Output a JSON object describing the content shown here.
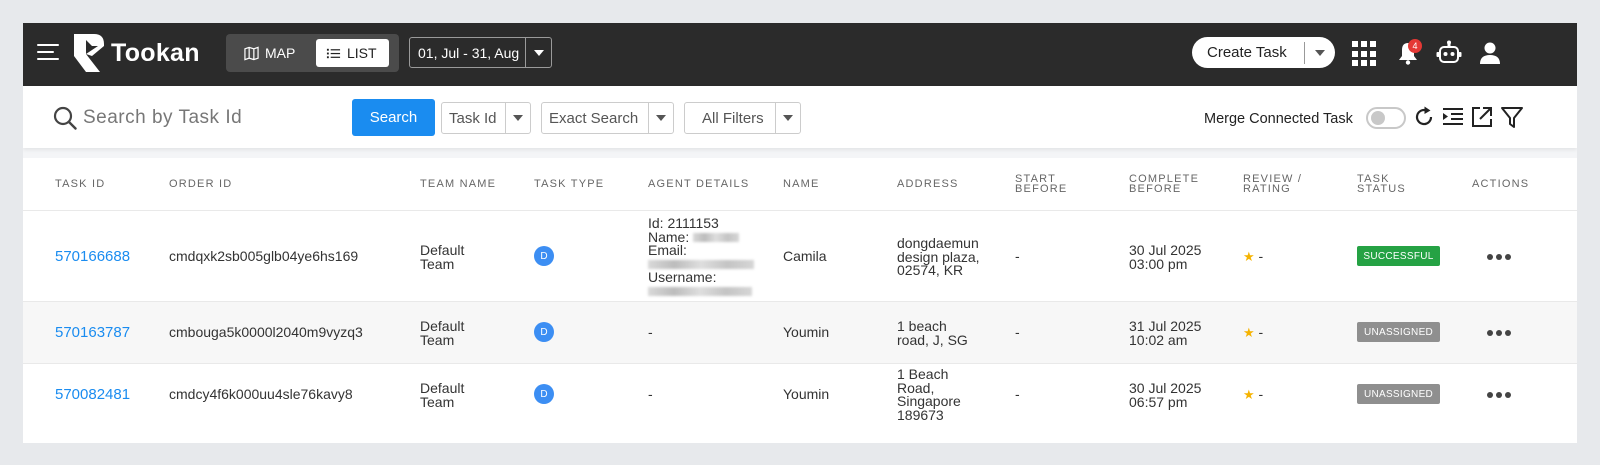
{
  "topbar": {
    "brand": "Tookan",
    "view_map_label": "MAP",
    "view_list_label": "LIST",
    "date_range": "01, Jul - 31, Aug",
    "create_task_label": "Create Task",
    "notification_count": "4"
  },
  "search": {
    "placeholder": "Search by Task Id",
    "button_label": "Search",
    "field_select": "Task Id",
    "mode_select": "Exact Search",
    "filters_label": "All Filters",
    "merge_label": "Merge Connected Task"
  },
  "table": {
    "headers": {
      "task_id": "TASK ID",
      "order_id": "ORDER ID",
      "team_name": "TEAM NAME",
      "task_type": "TASK TYPE",
      "agent_details": "AGENT DETAILS",
      "name": "NAME",
      "address": "ADDRESS",
      "start_before_1": "START",
      "start_before_2": "BEFORE",
      "complete_before_1": "COMPLETE",
      "complete_before_2": "BEFORE",
      "review_1": "REVIEW /",
      "review_2": "RATING",
      "status_1": "TASK",
      "status_2": "STATUS",
      "actions": "ACTIONS"
    },
    "rows": [
      {
        "task_id": "570166688",
        "order_id": "cmdqxk2sb005glb04ye6hs169",
        "team_1": "Default",
        "team_2": "Team",
        "task_type": "D",
        "agent_id": "Id: 2111153",
        "agent_name_label": "Name:",
        "agent_email_label": "Email:",
        "agent_username_label": "Username:",
        "name": "Camila",
        "address_1": "dongdaemun",
        "address_2": "design plaza,",
        "address_3": "02574, KR",
        "start_before": "-",
        "complete_1": "30 Jul 2025",
        "complete_2": "03:00 pm",
        "rating": "-",
        "status": "SUCCESSFUL"
      },
      {
        "task_id": "570163787",
        "order_id": "cmbouga5k0000l2040m9vyzq3",
        "team_1": "Default",
        "team_2": "Team",
        "task_type": "D",
        "agent": "-",
        "name": "Youmin",
        "address_1": "1 beach",
        "address_2": "road, J, SG",
        "start_before": "-",
        "complete_1": "31 Jul 2025",
        "complete_2": "10:02 am",
        "rating": "-",
        "status": "UNASSIGNED"
      },
      {
        "task_id": "570082481",
        "order_id": "cmdcy4f6k000uu4sle76kavy8",
        "team_1": "Default",
        "team_2": "Team",
        "task_type": "D",
        "agent": "-",
        "name": "Youmin",
        "address_1": "1 Beach",
        "address_2": "Road,",
        "address_3": "Singapore",
        "address_4": "189673",
        "start_before": "-",
        "complete_1": "30 Jul 2025",
        "complete_2": "06:57 pm",
        "rating": "-",
        "status": "UNASSIGNED"
      }
    ]
  },
  "colors": {
    "topbar": "#2b2b2b",
    "accent_blue": "#1a8cf0",
    "success": "#25a244",
    "unassigned": "#8f8f8f",
    "badge_red": "#e53935"
  }
}
